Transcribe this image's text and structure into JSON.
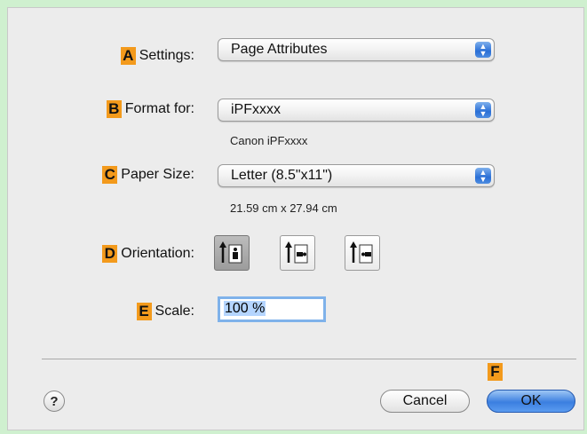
{
  "settings": {
    "badge": "A",
    "label": "Settings:",
    "value": "Page Attributes"
  },
  "format": {
    "badge": "B",
    "label": "Format for:",
    "value": "iPFxxxx",
    "sub": "Canon iPFxxxx"
  },
  "paper": {
    "badge": "C",
    "label": "Paper Size:",
    "value": "Letter (8.5\"x11\")",
    "sub": "21.59 cm x 27.94 cm"
  },
  "orientation": {
    "badge": "D",
    "label": "Orientation:"
  },
  "scale": {
    "badge": "E",
    "label": "Scale:",
    "value": "100 %"
  },
  "footer": {
    "badge": "F",
    "help": "?",
    "cancel": "Cancel",
    "ok": "OK"
  }
}
